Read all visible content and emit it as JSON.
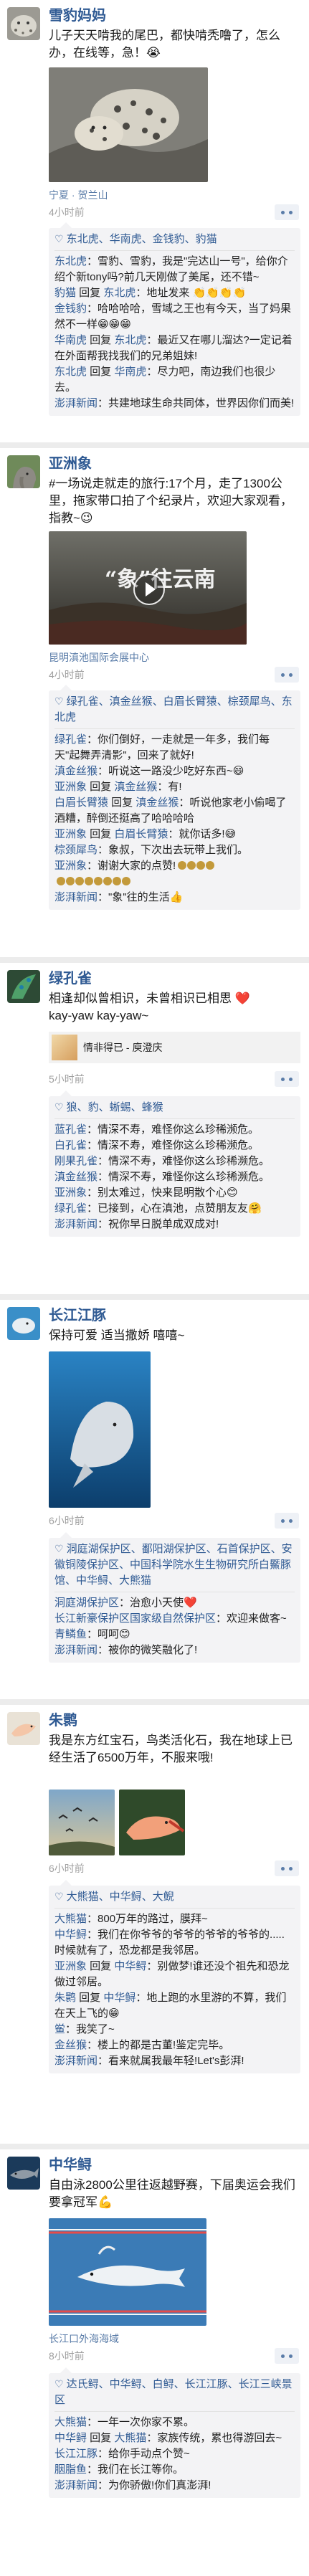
{
  "colors": {
    "name": "#2f5a93",
    "separator": "#ececec",
    "comment_bg": "#f3f3f5",
    "time": "#a0a0a0"
  },
  "posts": [
    {
      "name": "雪豹妈妈",
      "text": "儿子天天啃我的尾巴，都快啃秃噜了，怎么办，在线等，急！😭",
      "location": "宁夏 · 贺兰山",
      "time": "4小时前",
      "likes": "东北虎、华南虎、金钱豹、豹猫",
      "comments": [
        {
          "author": "东北虎",
          "text": "雪豹、雪豹，我是\"完达山一号\"，给你介绍个新tony吗?前几天刚做了美尾，还不错~"
        },
        {
          "author": "豹猫",
          "to": "东北虎",
          "text": "地址发来 👏👏👏👏"
        },
        {
          "author": "金钱豹",
          "text": "哈哈哈哈，雪域之王也有今天，当了妈果然不一样😁😁😁"
        },
        {
          "author": "华南虎",
          "to": "东北虎",
          "text": "最近又在哪儿溜达?一定记着在外面帮我找我们的兄弟姐妹!"
        },
        {
          "author": "东北虎",
          "to": "华南虎",
          "text": "尽力吧，南边我们也很少去。"
        },
        {
          "author": "澎湃新闻",
          "text": "共建地球生命共同体，世界因你们而美!"
        }
      ]
    },
    {
      "name": "亚洲象",
      "text": "#一场说走就走的旅行:17个月，走了1300公里，拖家带口拍了个纪录片，欢迎大家观看，指教~😉",
      "video_title": "“象”往云南",
      "location": "昆明滇池国际会展中心",
      "time": "4小时前",
      "likes": "绿孔雀、滇金丝猴、白眉长臂猿、棕颈犀鸟、东北虎",
      "comments": [
        {
          "author": "绿孔雀",
          "text": "你们倒好，一走就是一年多，我们每天\"起舞弄清影\"，回来了就好!"
        },
        {
          "author": "滇金丝猴",
          "text": "听说这一路没少吃好东西~😄"
        },
        {
          "author": "亚洲象",
          "to": "滇金丝猴",
          "text": "有!"
        },
        {
          "author": "白眉长臂猿",
          "to": "滇金丝猴",
          "text": "听说他家老小偷喝了酒糟，醉倒还挺高了哈哈哈哈"
        },
        {
          "author": "亚洲象",
          "to": "白眉长臂猿",
          "text": "就你话多!😅"
        },
        {
          "author": "棕颈犀鸟",
          "text": "象叔，下次出去玩带上我们。"
        },
        {
          "author": "亚洲象",
          "text": "谢谢大家的点赞!",
          "pins": 4
        },
        {
          "author": "",
          "text": "",
          "pins": 8
        },
        {
          "author": "澎湃新闻",
          "text": "\"象\"往的生活👍"
        }
      ]
    },
    {
      "name": "绿孔雀",
      "text": "相逢却似曾相识，未曾相识已相思 ❤️",
      "text2": "kay-yaw kay-yaw~",
      "link": "情非得已 - 庾澄庆",
      "time": "5小时前",
      "likes": "狼、豹、蜥蜴、蜂猴",
      "comments": [
        {
          "author": "蓝孔雀",
          "text": "情深不寿，难怪你这么珍稀濒危。"
        },
        {
          "author": "白孔雀",
          "text": "情深不寿，难怪你这么珍稀濒危。"
        },
        {
          "author": "刚果孔雀",
          "text": "情深不寿，难怪你这么珍稀濒危。"
        },
        {
          "author": "滇金丝猴",
          "text": "情深不寿，难怪你这么珍稀濒危。"
        },
        {
          "author": "亚洲象",
          "text": "别太难过，快来昆明散个心😊"
        },
        {
          "author": "绿孔雀",
          "text": "已接到，心在滇池，点赞朋友友🤗"
        },
        {
          "author": "澎湃新闻",
          "text": "祝你早日脱单成双成对!"
        }
      ]
    },
    {
      "name": "长江江豚",
      "text": "保持可爱 适当撒娇 嘻嘻~",
      "time": "6小时前",
      "likes": "洞庭湖保护区、鄱阳湖保护区、石首保护区、安徽铜陵保护区、中国科学院水生生物研究所白鱀豚馆、中华鲟、大熊猫",
      "comments": [
        {
          "author": "洞庭湖保护区",
          "text": "治愈小天使❤️"
        },
        {
          "author": "长江新豪保护区国家级自然保护区",
          "text": "欢迎来做客~"
        },
        {
          "author": "青鳞鱼",
          "text": "呵呵😊"
        },
        {
          "author": "澎湃新闻",
          "text": "被你的微笑融化了!"
        }
      ]
    },
    {
      "name": "朱鹮",
      "text": "我是东方红宝石，鸟类活化石，我在地球上已经生活了6500万年，不服来哦!",
      "time": "6小时前",
      "likes": "大熊猫、中华鲟、大鲵",
      "comments": [
        {
          "author": "大熊猫",
          "text": "800万年的路过，膜拜~"
        },
        {
          "author": "中华鲟",
          "text": "我们在你爷爷的爷爷的爷爷的爷爷的.....时候就有了，恐龙都是我邻居。"
        },
        {
          "author": "亚洲象",
          "to": "中华鲟",
          "text": "别做梦!谁还没个祖先和恐龙做过邻居。"
        },
        {
          "author": "朱鹮",
          "to": "中华鲟",
          "text": "地上跑的水里游的不算，我们在天上飞的😁"
        },
        {
          "author": "鲎",
          "text": "我笑了~"
        },
        {
          "author": "金丝猴",
          "text": "楼上的都是古董!鉴定完毕。"
        },
        {
          "author": "澎湃新闻",
          "text": "看来就属我最年轻!Let's彭湃!"
        }
      ]
    },
    {
      "name": "中华鲟",
      "text": "自由泳2800公里往返越野赛，下届奥运会我们要拿冠军💪",
      "location": "长江口外海海域",
      "time": "8小时前",
      "likes": "达氏鲟、中华鲟、白鲟、长江江豚、长江三峡景区",
      "comments": [
        {
          "author": "大熊猫",
          "text": "一年一次你家不累。"
        },
        {
          "author": "中华鲟",
          "to": "大熊猫",
          "text": "家族传统，累也得游回去~"
        },
        {
          "author": "长江江豚",
          "text": "给你手动点个赞~"
        },
        {
          "author": "胭脂鱼",
          "text": "我们在长江等你。"
        },
        {
          "author": "澎湃新闻",
          "text": "为你骄傲!你们真澎湃!"
        }
      ]
    }
  ]
}
